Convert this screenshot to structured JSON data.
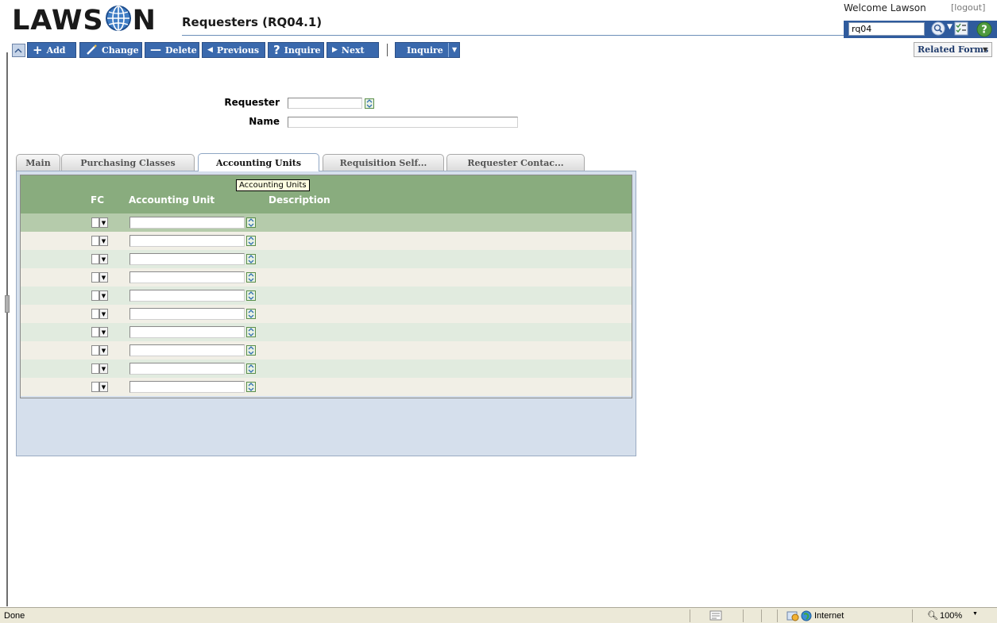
{
  "app": {
    "brand_pre": "LAWS",
    "brand_post": "N",
    "title": "Requesters (RQ04.1)"
  },
  "user": {
    "welcome": "Welcome Lawson",
    "logout": "[logout]"
  },
  "search": {
    "value": "rq04"
  },
  "toolbar": {
    "add": "Add",
    "change": "Change",
    "delete": "Delete",
    "previous": "Previous",
    "inquire": "Inquire",
    "next": "Next",
    "inquire_menu": "Inquire",
    "related_forms": "Related Forms"
  },
  "form": {
    "requester": {
      "label": "Requester",
      "value": ""
    },
    "name": {
      "label": "Name",
      "value": ""
    }
  },
  "tabs": [
    {
      "label": "Main"
    },
    {
      "label": "Purchasing Classes"
    },
    {
      "label": "Accounting Units"
    },
    {
      "label": "Requisition Self..."
    },
    {
      "label": "Requester Contac..."
    }
  ],
  "tooltip": "Accounting Units",
  "grid": {
    "headers": {
      "fc": "FC",
      "accounting_unit": "Accounting Unit",
      "description": "Description"
    },
    "rows": [
      {
        "accounting_unit": ""
      },
      {
        "accounting_unit": ""
      },
      {
        "accounting_unit": ""
      },
      {
        "accounting_unit": ""
      },
      {
        "accounting_unit": ""
      },
      {
        "accounting_unit": ""
      },
      {
        "accounting_unit": ""
      },
      {
        "accounting_unit": ""
      },
      {
        "accounting_unit": ""
      },
      {
        "accounting_unit": ""
      }
    ]
  },
  "statusbar": {
    "state": "Done",
    "zone": "Internet",
    "zoom": "100%"
  },
  "colors": {
    "toolbar": "#3a69ad",
    "grid_header": "#89ac7e",
    "panel": "#d5dfec"
  }
}
